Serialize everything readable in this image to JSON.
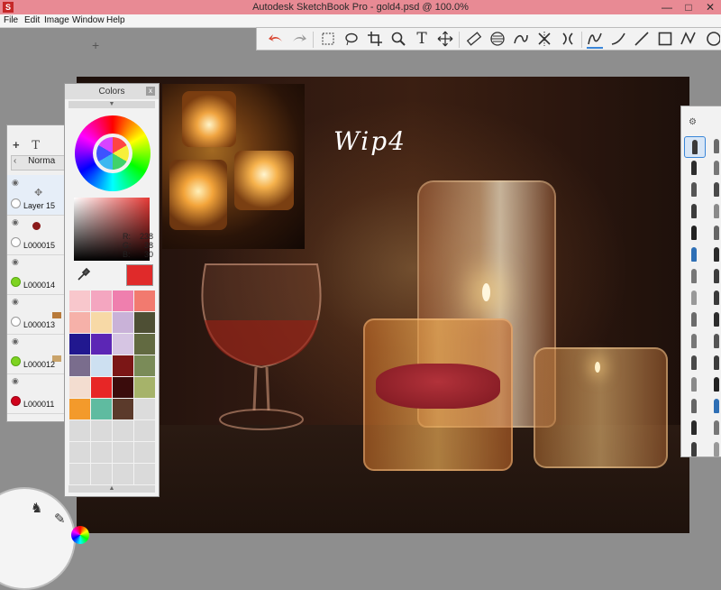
{
  "app": {
    "title": "Autodesk SketchBook Pro - gold4.psd @ 100.0%",
    "icon_letter": "S",
    "window_controls": [
      "—",
      "□",
      "✕"
    ]
  },
  "menu": [
    "File",
    "Edit",
    "Image",
    "Window",
    "Help"
  ],
  "toolbar": {
    "tools": [
      "undo-icon",
      "redo-icon",
      "rect-select-icon",
      "lasso-icon",
      "crop-icon",
      "zoom-icon",
      "text-icon",
      "move-icon",
      "ruler-icon",
      "ellipse-guide-icon",
      "french-curve-icon",
      "symmetry-x-icon",
      "symmetry-y-icon",
      "stroke-icon",
      "curve-icon",
      "line-icon",
      "rectangle-icon",
      "polyline-icon",
      "ellipse-icon"
    ],
    "selected": "stroke-icon"
  },
  "canvas": {
    "annotation": "Wip4"
  },
  "colors_panel": {
    "title": "Colors",
    "close": "x",
    "rgb": {
      "r_label": "R:",
      "r": "238",
      "g_label": "G:",
      "g": "38",
      "b_label": "B:",
      "b": "30"
    },
    "current_color": "#e02a2a",
    "swatches": [
      "#f8c7cc",
      "#f4a6c0",
      "#ef7fae",
      "#f27a6f",
      "#f6b1a9",
      "#f7d9a6",
      "#c9b2d8",
      "#4e4f34",
      "#21188f",
      "#5c26b5",
      "#d6c5e3",
      "#626a41",
      "#7a6d8d",
      "#cde0f1",
      "#7b1616",
      "#7a8b58",
      "#f3ddd0",
      "#e72626",
      "#3a0c0c",
      "#a6b36a",
      "#f39a2b",
      "#5fbba0",
      "#5b3a2b",
      "#dcdcdc",
      "#dadada",
      "#dadada",
      "#dadada",
      "#dadada",
      "#dadada",
      "#dadada",
      "#dadada",
      "#dadada",
      "#dadada",
      "#dadada",
      "#dadada",
      "#dadada"
    ]
  },
  "layers_panel": {
    "tools": [
      "+",
      "T"
    ],
    "blend_mode": "Norma",
    "layers": [
      {
        "name": "Layer 15",
        "dot": "#ffffff"
      },
      {
        "name": "L000015",
        "dot": "#ffffff"
      },
      {
        "name": "L000014",
        "dot": "#7ed321"
      },
      {
        "name": "L000013",
        "dot": "#ffffff"
      },
      {
        "name": "L000012",
        "dot": "#7ed321"
      },
      {
        "name": "L000011",
        "dot": "#d0021b"
      }
    ]
  },
  "accent_color": "#3a86d8"
}
